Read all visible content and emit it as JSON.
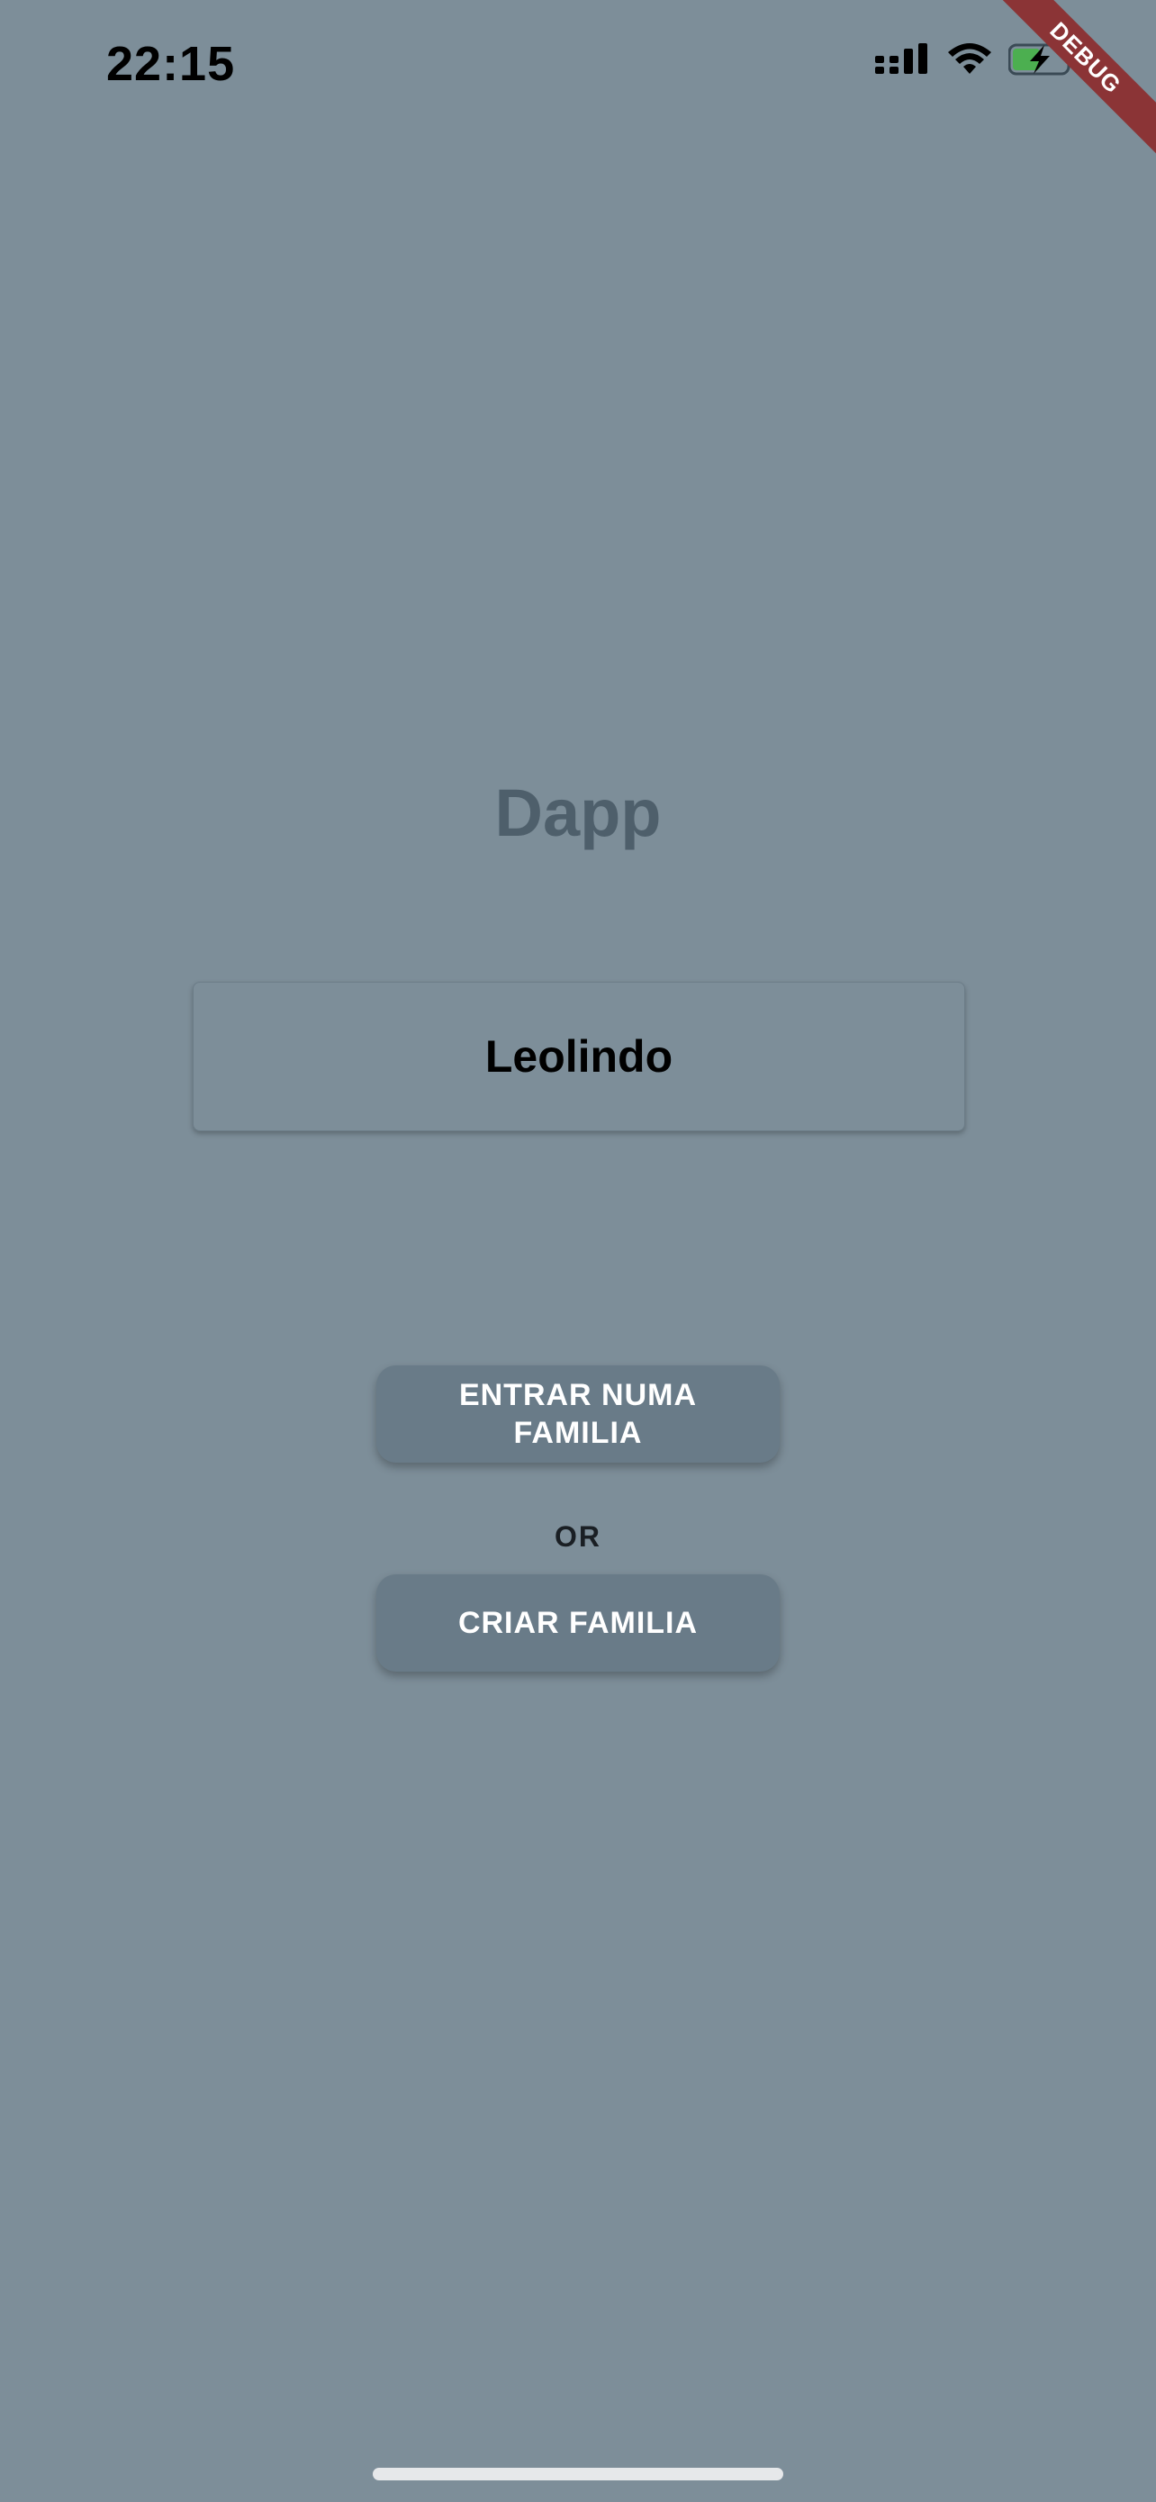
{
  "status_bar": {
    "time": "22:15"
  },
  "debug_banner": {
    "label": "DEBUG",
    "color": "#8b3436"
  },
  "app": {
    "title": "Dapp"
  },
  "name_field": {
    "value": "Leolindo"
  },
  "buttons": {
    "join_family": "ENTRAR NUMA FAMILIA",
    "or_label": "OR",
    "create_family": "CRIAR FAMILIA"
  },
  "colors": {
    "background": "#7d8e99",
    "button": "#697b88",
    "title": "#4e5f6b",
    "battery_fill": "#4caf50"
  },
  "icons": [
    "cellular-signal-icon",
    "wifi-icon",
    "battery-charging-icon"
  ]
}
